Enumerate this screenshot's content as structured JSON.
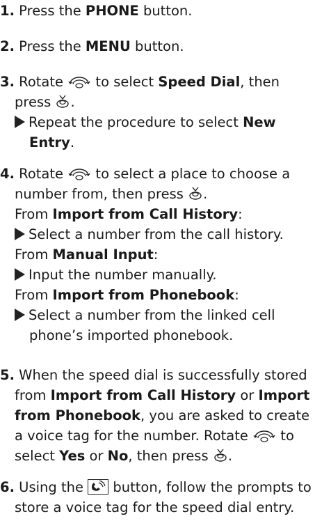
{
  "steps": [
    {
      "num": "1.",
      "pre": " Press the ",
      "bold": "PHONE",
      "post": " button."
    },
    {
      "num": "2.",
      "pre": " Press the ",
      "bold": "MENU",
      "post": " button."
    },
    {
      "num": "3.",
      "pre": " Rotate",
      "mid": " to select ",
      "bold": "Speed Dial",
      "post": ", then",
      "line2_pre": "press ",
      "line2_post": ".",
      "sub_pre": "Repeat the procedure to select ",
      "sub_bold1": "New",
      "sub_bold2": "Entry",
      "sub_post": "."
    },
    {
      "num": "4.",
      "pre": " Rotate",
      "mid": " to select a place to choose a",
      "line2_pre": "number from, then press ",
      "line2_post": ".",
      "from1_pre": "From ",
      "from1_bold": "Import from Call History",
      "from1_post": ":",
      "from1_sub": "Select a number from the call history.",
      "from2_pre": "From ",
      "from2_bold": "Manual Input",
      "from2_post": ":",
      "from2_sub": "Input the number manually.",
      "from3_pre": "From ",
      "from3_bold": "Import from Phonebook",
      "from3_post": ":",
      "from3_sub1": "Select a number from the linked cell",
      "from3_sub2": "phone’s imported phonebook."
    },
    {
      "num": "5.",
      "l1": " When the speed dial is successfully stored",
      "l2_pre": "from ",
      "l2_bold1": "Import from Call History",
      "l2_mid": " or ",
      "l2_bold2": "Import",
      "l3_bold": "from Phonebook",
      "l3_post": ", you are asked to create",
      "l4_pre": "a voice tag for the number. Rotate",
      "l4_post": " to",
      "l5_pre": "select ",
      "l5_bold1": "Yes",
      "l5_mid": " or ",
      "l5_bold2": "No",
      "l5_post": ", then press ",
      "l5_end": "."
    },
    {
      "num": "6.",
      "l1_pre": " Using the ",
      "l1_post": " button, follow the prompts to",
      "l2": "store a voice tag for the speed dial entry."
    }
  ],
  "icons": {
    "dial": "rotary-knob-icon",
    "press": "press-enter-icon",
    "talk": "talk-button-icon"
  }
}
